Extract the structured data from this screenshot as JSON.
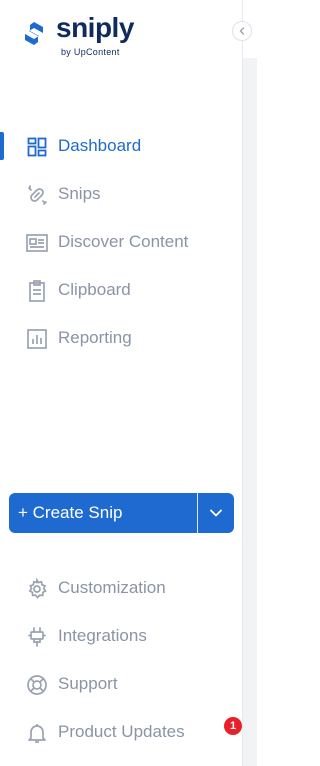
{
  "brand": {
    "name": "sniply",
    "tagline": "by UpContent"
  },
  "colors": {
    "accent": "#1e6ad1",
    "text_muted": "#8a94a6",
    "brand_dark": "#0e2b5c",
    "badge_red": "#e8202a"
  },
  "nav": {
    "primary": [
      {
        "label": "Dashboard",
        "icon": "dashboard-icon",
        "active": true
      },
      {
        "label": "Snips",
        "icon": "link-icon",
        "active": false
      },
      {
        "label": "Discover Content",
        "icon": "newspaper-icon",
        "active": false
      },
      {
        "label": "Clipboard",
        "icon": "clipboard-icon",
        "active": false
      },
      {
        "label": "Reporting",
        "icon": "chart-icon",
        "active": false
      }
    ],
    "secondary": [
      {
        "label": "Customization",
        "icon": "gear-icon"
      },
      {
        "label": "Integrations",
        "icon": "plug-icon"
      },
      {
        "label": "Support",
        "icon": "lifebuoy-icon"
      },
      {
        "label": "Product Updates",
        "icon": "bell-icon",
        "badge": "1"
      }
    ]
  },
  "create": {
    "label": "+ Create Snip",
    "dropdown_icon": "chevron-down-icon"
  },
  "collapse": {
    "icon": "chevron-left-icon"
  }
}
